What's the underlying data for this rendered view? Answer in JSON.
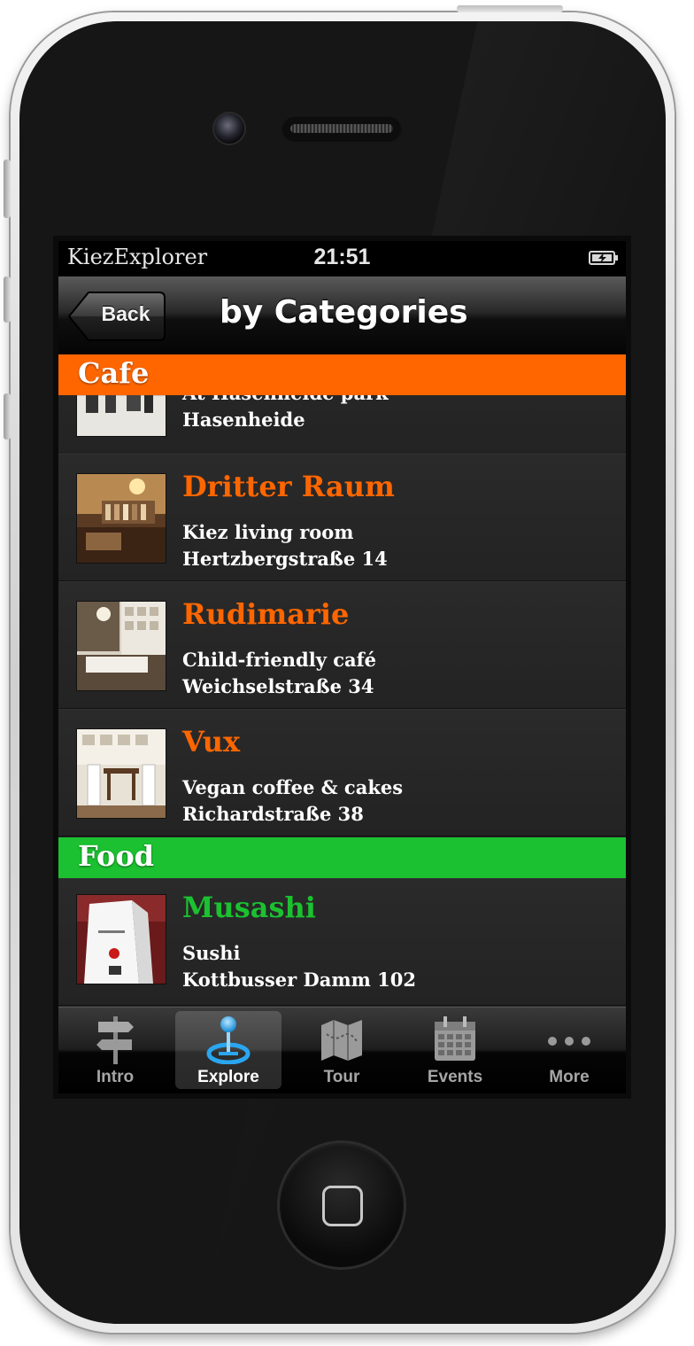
{
  "status_bar": {
    "carrier": "KiezExplorer",
    "time": "21:51",
    "battery_icon": "battery-charging-icon"
  },
  "nav": {
    "back_label": "Back",
    "title": "by Categories"
  },
  "sections": [
    {
      "name": "Cafe",
      "color": "#ff6600",
      "items": [
        {
          "name": "",
          "description": "At Hasenheide park",
          "address": "Hasenheide",
          "partial": true
        },
        {
          "name": "Dritter Raum",
          "description": "Kiez living room",
          "address": "Hertzbergstraße 14"
        },
        {
          "name": "Rudimarie",
          "description": "Child-friendly café",
          "address": "Weichselstraße 34"
        },
        {
          "name": "Vux",
          "description": "Vegan coffee & cakes",
          "address": "Richardstraße 38"
        }
      ]
    },
    {
      "name": "Food",
      "color": "#1bc130",
      "items": [
        {
          "name": "Musashi",
          "description": "Sushi",
          "address": "Kottbusser Damm 102"
        }
      ]
    }
  ],
  "tab_bar": {
    "selected": "Explore",
    "tabs": [
      {
        "label": "Intro",
        "icon": "signpost-icon"
      },
      {
        "label": "Explore",
        "icon": "map-pin-icon"
      },
      {
        "label": "Tour",
        "icon": "map-icon"
      },
      {
        "label": "Events",
        "icon": "calendar-icon"
      },
      {
        "label": "More",
        "icon": "more-dots-icon"
      }
    ]
  }
}
